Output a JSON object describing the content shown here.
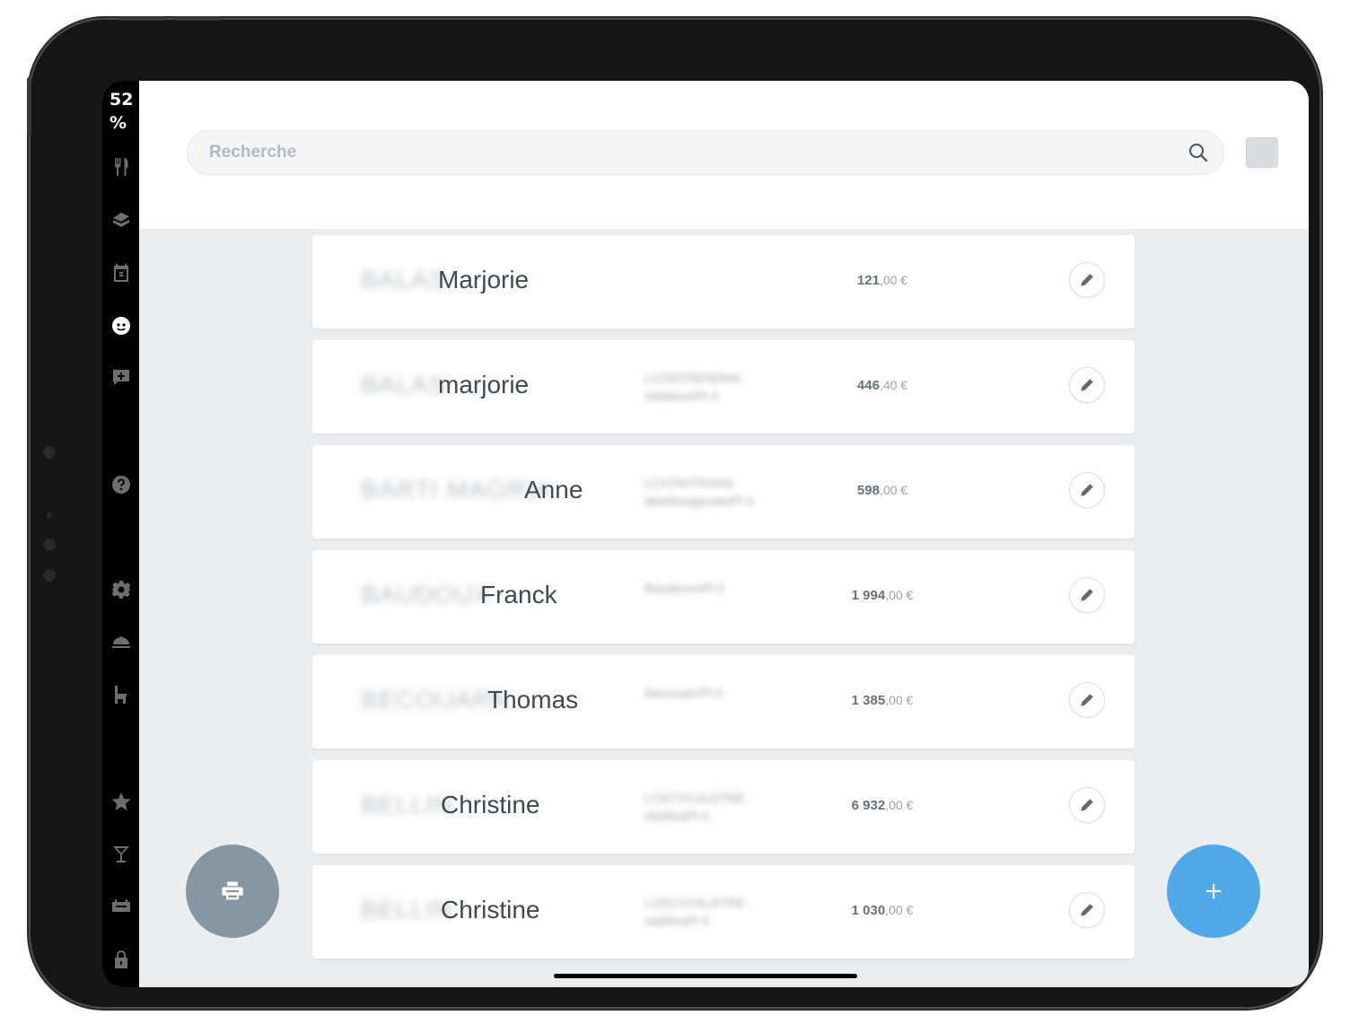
{
  "status": {
    "battery": "52\n%"
  },
  "search": {
    "placeholder": "Recherche",
    "value": ""
  },
  "sidebar": {
    "items": [
      {
        "icon": "fork-knife-icon",
        "active": false
      },
      {
        "icon": "bag-icon",
        "active": false
      },
      {
        "icon": "calendar-icon",
        "active": false
      },
      {
        "icon": "customer-face-icon",
        "active": true
      },
      {
        "icon": "chat-plus-icon",
        "active": false
      },
      {
        "icon": "help-icon",
        "active": false
      },
      {
        "icon": "settings-gear-icon",
        "active": false
      },
      {
        "icon": "dish-cloche-icon",
        "active": false
      },
      {
        "icon": "chair-icon",
        "active": false
      },
      {
        "icon": "star-icon",
        "active": false
      },
      {
        "icon": "cocktail-icon",
        "active": false
      },
      {
        "icon": "cash-drawer-icon",
        "active": false
      },
      {
        "icon": "lock-icon",
        "active": false
      }
    ]
  },
  "customers": [
    {
      "lastname": "BALAS",
      "firstname": "Marjorie",
      "info1": "",
      "info2": "",
      "amount_int": "121",
      "amount_dec": ",00 €"
    },
    {
      "lastname": "BALAS",
      "firstname": "marjorie",
      "info1": "LCONTRENDMA",
      "info2": "mbalaumPt it",
      "amount_int": "446",
      "amount_dec": ",40 €"
    },
    {
      "lastname": "BARTI MAGRIA",
      "firstname": "Anne",
      "info1": "LCSTAVTRANS",
      "info2": "abartimagruaesPt it",
      "amount_int": "598",
      "amount_dec": ",00 €"
    },
    {
      "lastname": "BAUDOUX",
      "firstname": "Franck",
      "info1": "",
      "info2": "fbaudouxsPt it",
      "amount_int": "1 994",
      "amount_dec": ",00 €"
    },
    {
      "lastname": "BECOUARN",
      "firstname": "Thomas",
      "info1": "",
      "info2": "tbecouarnPt it",
      "amount_int": "1 385",
      "amount_dec": ",00 €"
    },
    {
      "lastname": "BELLIN",
      "firstname": "Christine",
      "info1": "LCECVCALDTRE",
      "info2": "cbellinaPt it",
      "amount_int": "6 932",
      "amount_dec": ",00 €"
    },
    {
      "lastname": "BELLIN",
      "firstname": "Christine",
      "info1": "LCECVCALDTRE",
      "info2": "cbellinaPt it",
      "amount_int": "1 030",
      "amount_dec": ",00 €"
    }
  ],
  "colors": {
    "accent": "#4fa9ea",
    "print_button": "#8896a2",
    "background": "#ebeef1"
  },
  "actions": {
    "add_label": "+",
    "print_icon": "printer-icon",
    "edit_icon": "pencil-icon"
  }
}
